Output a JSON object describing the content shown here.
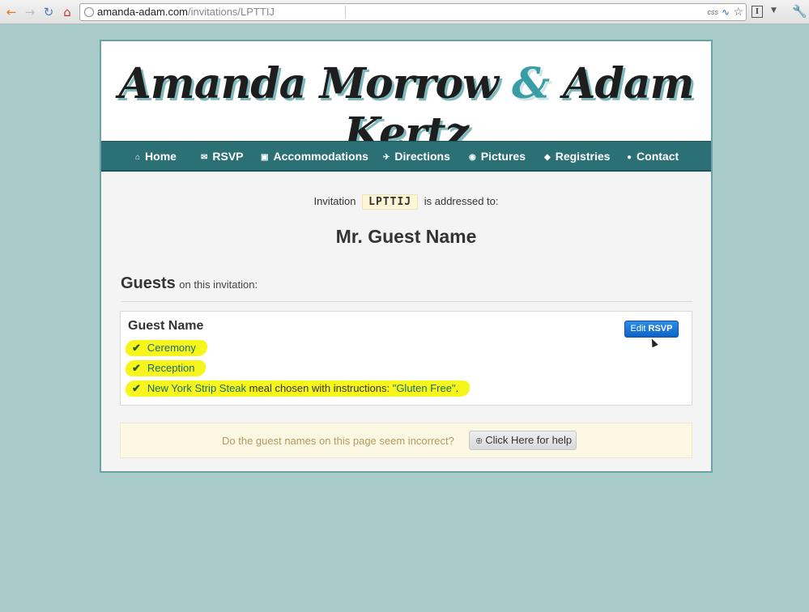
{
  "browser": {
    "url_host": "amanda-adam.com",
    "url_path": "/invitations/LPTTIJ",
    "css_badge": "css"
  },
  "banner": {
    "name_one": "Amanda Morrow",
    "ampersand": "&",
    "name_two": "Adam Kertz"
  },
  "nav": {
    "items": [
      {
        "label": "Home",
        "icon": "home-icon"
      },
      {
        "label": "RSVP",
        "icon": "envelope-icon"
      },
      {
        "label": "Accommodations",
        "icon": "suitcase-icon"
      },
      {
        "label": "Directions",
        "icon": "plane-icon"
      },
      {
        "label": "Pictures",
        "icon": "camera-icon"
      },
      {
        "label": "Registries",
        "icon": "tag-icon"
      },
      {
        "label": "Contact",
        "icon": "chat-bubble-icon"
      }
    ]
  },
  "invitation": {
    "prefix": "Invitation",
    "code": "LPTTIJ",
    "suffix": "is addressed to:",
    "addressee": "Mr. Guest Name"
  },
  "guests": {
    "heading": "Guests",
    "subheading": "on this invitation:",
    "list": [
      {
        "name": "Guest Name",
        "edit_label_1": "Edit",
        "edit_label_2": "RSVP",
        "events": [
          "Ceremony",
          "Reception"
        ],
        "meal": {
          "item": "New York Strip Steak",
          "middle": "meal chosen with instructions:",
          "instructions": "\"Gluten Free\"",
          "end": "."
        }
      }
    ]
  },
  "help": {
    "question": "Do the guest names on this page seem incorrect?",
    "button_label": "Click Here for help"
  },
  "colors": {
    "background": "#a8cac8",
    "nav": "#2b7075",
    "accent": "#3a9da5",
    "highlight": "#f6f51c",
    "button": "#0d63c6"
  }
}
